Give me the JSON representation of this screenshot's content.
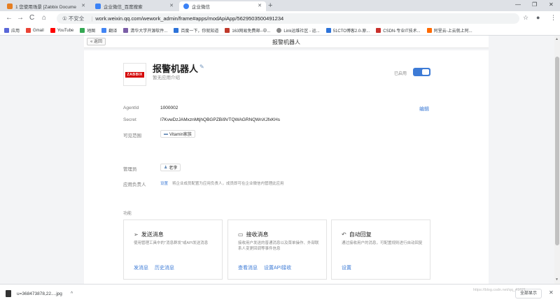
{
  "tabs": [
    {
      "title": "1 您使用场景 [Zabbix Docume",
      "color": "#e67e22"
    },
    {
      "title": "企业微信_百度搜索",
      "color": "#3b82f6"
    },
    {
      "title": "企业微信",
      "color": "#3b82f6"
    }
  ],
  "window_controls": {
    "minimize": "—",
    "maximize": "❐",
    "close": "✕"
  },
  "toolbar": {
    "back": "←",
    "forward": "→",
    "reload": "C",
    "home": "⌂",
    "security": "① 不安全",
    "url": "work.weixin.qq.com/wework_admin/frame#apps/modApiApp/5629503500491234",
    "star": "☆",
    "profile": "●",
    "menu": "⋮"
  },
  "bookmarks": [
    {
      "label": "应用",
      "color": "#5a67d8"
    },
    {
      "label": "Gmail",
      "color": "#ea4335"
    },
    {
      "label": "YouTube",
      "color": "#ff0000"
    },
    {
      "label": "地图",
      "color": "#34a853"
    },
    {
      "label": "翻译",
      "color": "#4285f4"
    },
    {
      "label": "清华大学开源软件...",
      "color": "#7b5ea7"
    },
    {
      "label": "百度一下，你就知道",
      "color": "#2d73d9"
    },
    {
      "label": "163网易免费邮--中...",
      "color": "#c0392b"
    },
    {
      "label": "Link运维社区 - 运...",
      "color": "#888888"
    },
    {
      "label": "51CTO博客2.0-原...",
      "color": "#2d73d9"
    },
    {
      "label": "CSDN-专业IT技术...",
      "color": "#c9302c"
    },
    {
      "label": "阿里云-上云就上阿...",
      "color": "#ff6a00"
    }
  ],
  "subheader": {
    "back_label": "« 返回",
    "title": "报警机器人"
  },
  "app": {
    "logo_text": "ZABBIX",
    "name": "报警机器人",
    "description": "暂无应用介绍",
    "enabled_label": "已启用",
    "enabled": true
  },
  "details": {
    "agentid_label": "AgentId",
    "agentid_value": "1000002",
    "secret_label": "Secret",
    "secret_value": "I7KvwDzJAMxznMtjhQBGPZBi9VTQWAGRNQWnXJfxKHs",
    "visible_label": "可见范围",
    "visible_value": "Vitamin家族",
    "edit_label": "编辑",
    "admin_label": "管理员",
    "admin_value": "老李",
    "owner_label": "应用负责人",
    "owner_link": "设置",
    "owner_hint": "将企业成员配置为应用负责人，成员即可在企业微信内管理此应用"
  },
  "functions": {
    "section_title": "功能",
    "cards": [
      {
        "icon": "send-icon",
        "title": "发送消息",
        "description": "使用管理工具中的\"消息群发\"或API发送消息",
        "links": [
          "发消息",
          "历史消息"
        ]
      },
      {
        "icon": "chat-icon",
        "title": "接收消息",
        "description": "接收用户发送的普通消息以及菜单操作、外部联系人变更回调等事件信息",
        "links": [
          "查看消息",
          "设置API接收"
        ]
      },
      {
        "icon": "reply-icon",
        "title": "自动回复",
        "description": "通过接收用户的消息，可配置规则进行自动回复",
        "links": [
          "设置"
        ]
      }
    ]
  },
  "download": {
    "filename": "u=368473878,22....jpg",
    "show_all": "全部显示",
    "close": "✕"
  },
  "watermark": "https://blog.csdn.net/qq_41621..."
}
